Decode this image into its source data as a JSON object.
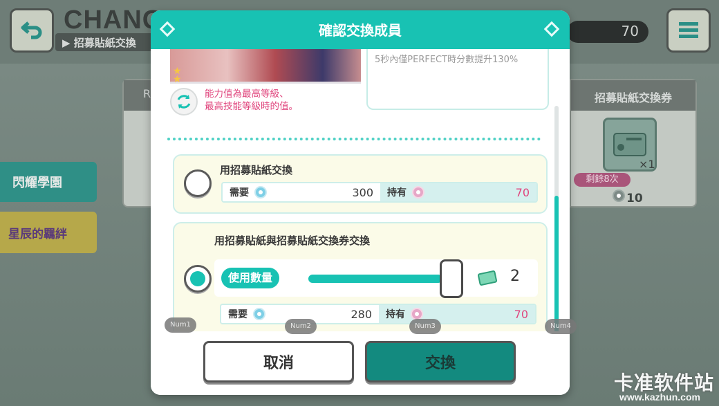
{
  "background": {
    "title": "CHANG",
    "subtitle": "▶ 招募貼紙交換",
    "count": "70",
    "side_banner_1": "閃耀學園",
    "side_banner_2": "星辰的羈絆",
    "left_card_head": "R",
    "right_card": {
      "head": "招募貼紙交換券",
      "multiplier": "×1",
      "remaining": "剩餘8次",
      "cost": "10"
    },
    "watermark": "卡准软件站",
    "watermark_url": "www.kazhun.com"
  },
  "modal": {
    "title": "確認交換成員",
    "skill_text": "5秒內僅PERFECT時分數提升130%",
    "info_text_line1": "能力值為最高等級、",
    "info_text_line2": "最高技能等級時的值。",
    "option1": {
      "title": "用招募貼紙交換",
      "need_label": "需要",
      "need_value": "300",
      "have_label": "持有",
      "have_value": "70"
    },
    "option2": {
      "title": "用招募貼紙與招募貼紙交換券交換",
      "qty_label": "使用數量",
      "qty_value": "2",
      "need_label": "需要",
      "need_value": "280",
      "have_label": "持有",
      "have_value": "70"
    },
    "hints": [
      "Num1",
      "Num2",
      "Num3",
      "Num4"
    ],
    "cancel_label": "取消",
    "confirm_label": "交換"
  },
  "colors": {
    "accent": "#18c2b3",
    "pink": "#e0457d",
    "confirm": "#138a7f"
  },
  "slider_fraction": 1.0
}
